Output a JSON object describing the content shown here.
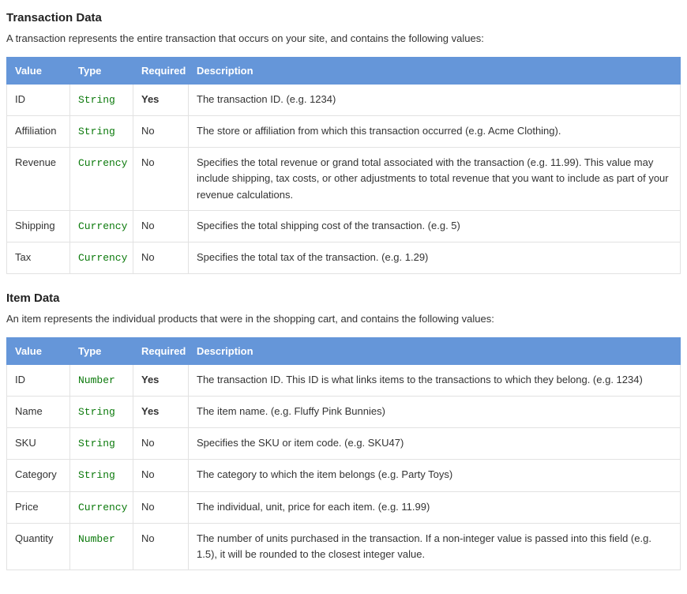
{
  "sections": [
    {
      "heading": "Transaction Data",
      "intro": "A transaction represents the entire transaction that occurs on your site, and contains the following values:",
      "columns": [
        "Value",
        "Type",
        "Required",
        "Description"
      ],
      "rows": [
        {
          "value": "ID",
          "type": "String",
          "required": "Yes",
          "description": "The transaction ID. (e.g. 1234)"
        },
        {
          "value": "Affiliation",
          "type": "String",
          "required": "No",
          "description": "The store or affiliation from which this transaction occurred (e.g. Acme Clothing)."
        },
        {
          "value": "Revenue",
          "type": "Currency",
          "required": "No",
          "description": "Specifies the total revenue or grand total associated with the transaction (e.g. 11.99). This value may include shipping, tax costs, or other adjustments to total revenue that you want to include as part of your revenue calculations."
        },
        {
          "value": "Shipping",
          "type": "Currency",
          "required": "No",
          "description": "Specifies the total shipping cost of the transaction. (e.g. 5)"
        },
        {
          "value": "Tax",
          "type": "Currency",
          "required": "No",
          "description": "Specifies the total tax of the transaction. (e.g. 1.29)"
        }
      ]
    },
    {
      "heading": "Item Data",
      "intro": "An item represents the individual products that were in the shopping cart, and contains the following values:",
      "columns": [
        "Value",
        "Type",
        "Required",
        "Description"
      ],
      "rows": [
        {
          "value": "ID",
          "type": "Number",
          "required": "Yes",
          "description": "The transaction ID. This ID is what links items to the transactions to which they belong. (e.g. 1234)"
        },
        {
          "value": "Name",
          "type": "String",
          "required": "Yes",
          "description": "The item name. (e.g. Fluffy Pink Bunnies)"
        },
        {
          "value": "SKU",
          "type": "String",
          "required": "No",
          "description": "Specifies the SKU or item code. (e.g. SKU47)"
        },
        {
          "value": "Category",
          "type": "String",
          "required": "No",
          "description": "The category to which the item belongs (e.g. Party Toys)"
        },
        {
          "value": "Price",
          "type": "Currency",
          "required": "No",
          "description": "The individual, unit, price for each item. (e.g. 11.99)"
        },
        {
          "value": "Quantity",
          "type": "Number",
          "required": "No",
          "description": "The number of units purchased in the transaction. If a non-integer value is passed into this field (e.g. 1.5), it will be rounded to the closest integer value."
        }
      ]
    }
  ],
  "colwidths": {
    "value": "80",
    "type": "80",
    "required": "70"
  }
}
